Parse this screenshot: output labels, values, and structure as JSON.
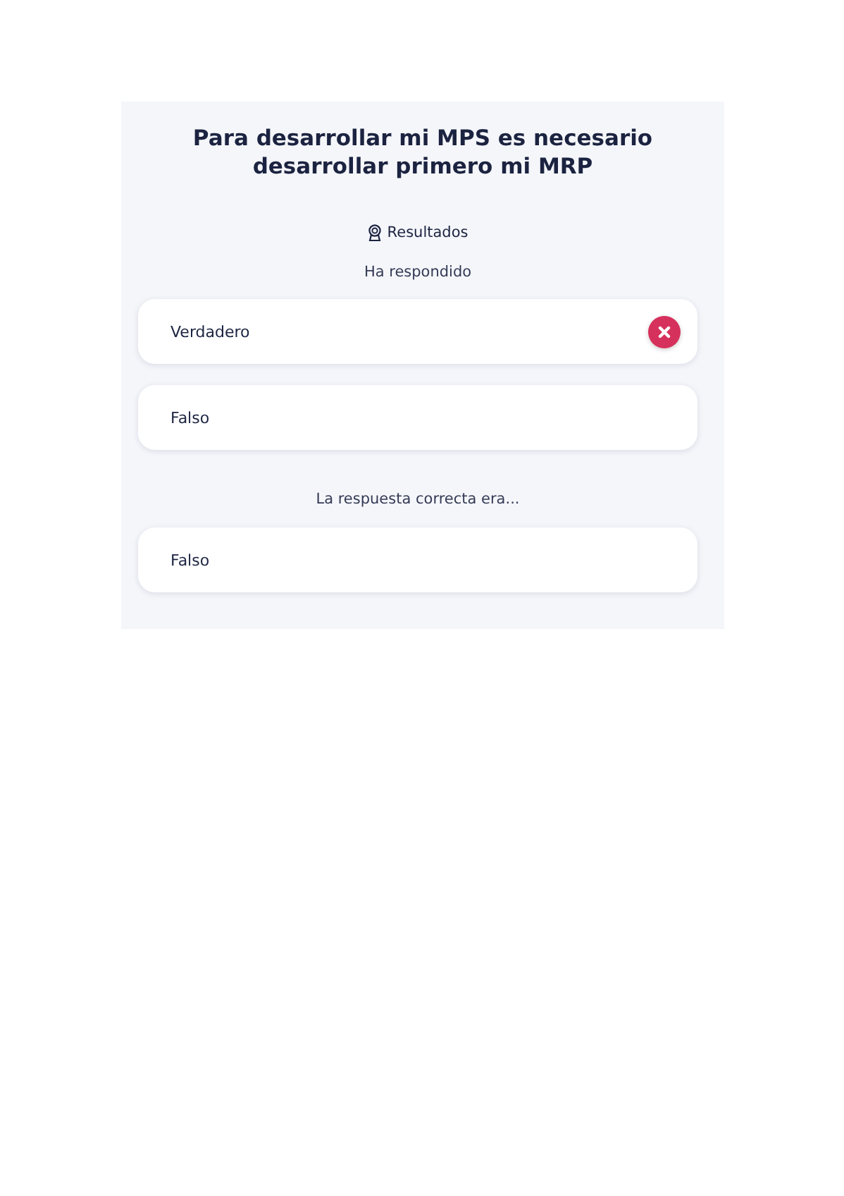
{
  "question": {
    "title": "Para desarrollar mi MPS es necesario desarrollar primero mi MRP"
  },
  "results_label": "Resultados",
  "answered_label": "Ha respondido",
  "answers": [
    {
      "text": "Verdadero",
      "wrong": true
    },
    {
      "text": "Falso",
      "wrong": false
    }
  ],
  "correct_label": "La respuesta correcta era...",
  "correct_answers": [
    {
      "text": "Falso"
    }
  ]
}
